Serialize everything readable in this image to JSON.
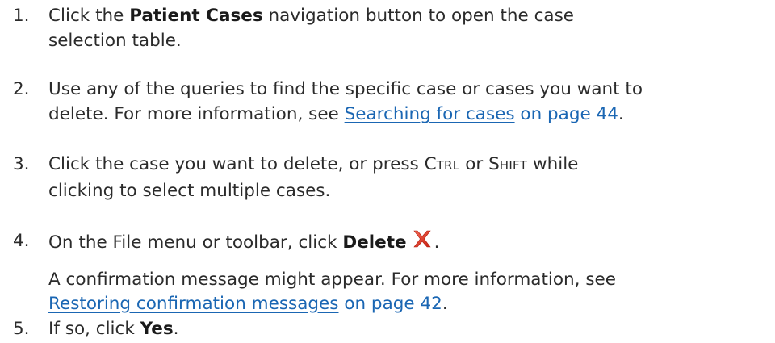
{
  "steps": [
    {
      "number": "1.",
      "line1_pre": "Click the ",
      "line1_bold": "Patient Cases",
      "line1_post": " navigation button to open the case",
      "line2": "selection table."
    },
    {
      "number": "2.",
      "line1": "Use any of the queries to find the specific case or cases you want to",
      "line2_pre": "delete. For more information, see ",
      "link_text": "Searching for cases",
      "page_ref": " on page 44",
      "line2_post": "."
    },
    {
      "number": "3.",
      "line1_pre": "Click the case you want to delete, or press ",
      "key1_first": "C",
      "key1_rest": "TRL",
      "line1_mid": " or ",
      "key2_first": "S",
      "key2_rest": "HIFT",
      "line1_post": " while",
      "line2": "clicking to select multiple cases."
    },
    {
      "number": "4.",
      "line1_pre": "On the File menu or toolbar, click ",
      "line1_bold": "Delete",
      "line1_post": ".",
      "icon": "delete-x-icon",
      "icon_color": "#e0301e",
      "note_line1": "A confirmation message might appear. For more information, see",
      "note_link_text": "Restoring confirmation messages",
      "note_page_ref": " on page 42",
      "note_post": "."
    },
    {
      "number": "5.",
      "line1_pre": "If so, click ",
      "line1_bold": "Yes",
      "line1_post": "."
    }
  ]
}
